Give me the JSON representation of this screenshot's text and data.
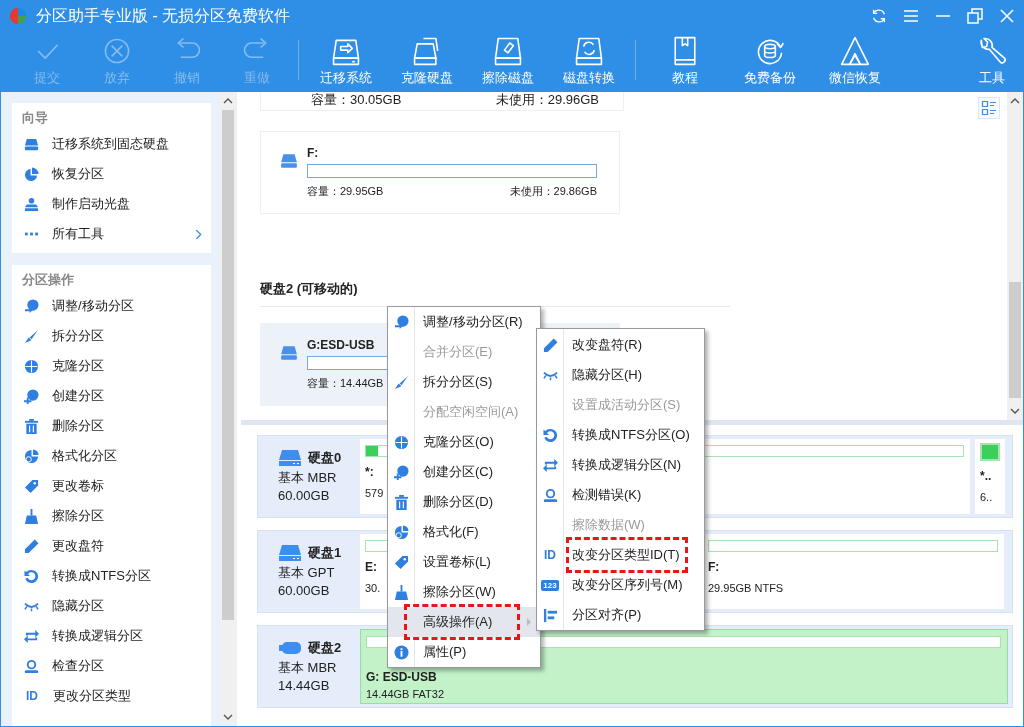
{
  "window": {
    "title": "分区助手专业版 - 无损分区免费软件"
  },
  "toolbar": {
    "groups": [
      [
        {
          "label": "提交",
          "disabled": true
        },
        {
          "label": "放弃",
          "disabled": true
        },
        {
          "label": "撤销",
          "disabled": true
        },
        {
          "label": "重做",
          "disabled": true
        }
      ],
      [
        {
          "label": "迁移系统",
          "disabled": false
        },
        {
          "label": "克隆硬盘",
          "disabled": false
        },
        {
          "label": "擦除磁盘",
          "disabled": false
        },
        {
          "label": "磁盘转换",
          "disabled": false
        }
      ],
      [
        {
          "label": "教程",
          "disabled": false
        },
        {
          "label": "免费备份",
          "disabled": false
        },
        {
          "label": "微信恢复",
          "disabled": false
        }
      ],
      [
        {
          "label": "工具",
          "disabled": false
        }
      ]
    ]
  },
  "sidebar": {
    "sections": [
      {
        "title": "向导",
        "items": [
          {
            "label": "迁移系统到固态硬盘",
            "has_submenu": false
          },
          {
            "label": "恢复分区",
            "has_submenu": false
          },
          {
            "label": "制作启动光盘",
            "has_submenu": false
          },
          {
            "label": "所有工具",
            "has_submenu": true
          }
        ]
      },
      {
        "title": "分区操作",
        "items": [
          {
            "label": "调整/移动分区",
            "has_submenu": false
          },
          {
            "label": "拆分分区",
            "has_submenu": false
          },
          {
            "label": "克隆分区",
            "has_submenu": false
          },
          {
            "label": "创建分区",
            "has_submenu": false
          },
          {
            "label": "删除分区",
            "has_submenu": false
          },
          {
            "label": "格式化分区",
            "has_submenu": false
          },
          {
            "label": "更改卷标",
            "has_submenu": false
          },
          {
            "label": "擦除分区",
            "has_submenu": false
          },
          {
            "label": "更改盘符",
            "has_submenu": false
          },
          {
            "label": "转换成NTFS分区",
            "has_submenu": false
          },
          {
            "label": "隐藏分区",
            "has_submenu": false
          },
          {
            "label": "转换成逻辑分区",
            "has_submenu": false
          },
          {
            "label": "检查分区",
            "has_submenu": false
          },
          {
            "label": "更改分区类型",
            "has_submenu": false,
            "icon_text": {
              "text": "ID",
              "boxed": false
            }
          }
        ]
      }
    ]
  },
  "volumes": {
    "partial_card": {
      "capacity": "容量：30.05GB",
      "unused": "未使用：29.96GB"
    },
    "cards": [
      {
        "name": "F:",
        "level": 0,
        "capacity": "容量：29.95GB",
        "unused": "未使用：29.86GB",
        "selected": false
      }
    ],
    "disk_heading": "硬盘2 (可移动的)",
    "removable_cards": [
      {
        "name": "G:ESD-USB",
        "level": 0,
        "capacity": "容量：14.44GB",
        "selected": true
      }
    ]
  },
  "disks": [
    {
      "name": "硬盘0",
      "kind": "hdd",
      "scheme": "基本 MBR",
      "size": "60.00GB",
      "partitions": [
        {
          "label": "*:",
          "info": "579",
          "level": 0.02,
          "selected": false
        },
        {
          "label": "*..",
          "info": "6..",
          "level": 1,
          "selected": false
        }
      ]
    },
    {
      "name": "硬盘1",
      "kind": "hdd",
      "scheme": "基本 GPT",
      "size": "60.00GB",
      "partitions": [
        {
          "label": "E:",
          "info": "30.",
          "level": 0,
          "selected": false
        },
        {
          "label": "F:",
          "info": "29.95GB NTFS",
          "level": 0,
          "selected": false
        }
      ]
    },
    {
      "name": "硬盘2",
      "kind": "usb",
      "scheme": "基本 MBR",
      "size": "14.44GB",
      "partitions": [
        {
          "label": "G: ESD-USB",
          "info": "14.44GB FAT32",
          "level": 0,
          "selected": true
        }
      ]
    }
  ],
  "context_menu": {
    "items": [
      {
        "label": "调整/移动分区(R)",
        "disabled": false,
        "hovered": false,
        "annotated": false,
        "has_submenu": false
      },
      {
        "label": "合并分区(E)",
        "disabled": true,
        "hovered": false,
        "annotated": false,
        "has_submenu": false
      },
      {
        "label": "拆分分区(S)",
        "disabled": false,
        "hovered": false,
        "annotated": false,
        "has_submenu": false
      },
      {
        "label": "分配空闲空间(A)",
        "disabled": true,
        "hovered": false,
        "annotated": false,
        "has_submenu": false
      },
      {
        "label": "克隆分区(O)",
        "disabled": false,
        "hovered": false,
        "annotated": false,
        "has_submenu": false
      },
      {
        "label": "创建分区(C)",
        "disabled": false,
        "hovered": false,
        "annotated": false,
        "has_submenu": false
      },
      {
        "label": "删除分区(D)",
        "disabled": false,
        "hovered": false,
        "annotated": false,
        "has_submenu": false
      },
      {
        "label": "格式化(F)",
        "disabled": false,
        "hovered": false,
        "annotated": false,
        "has_submenu": false
      },
      {
        "label": "设置卷标(L)",
        "disabled": false,
        "hovered": false,
        "annotated": false,
        "has_submenu": false
      },
      {
        "label": "擦除分区(W)",
        "disabled": false,
        "hovered": false,
        "annotated": false,
        "has_submenu": false
      },
      {
        "label": "高级操作(A)",
        "disabled": false,
        "hovered": true,
        "annotated": true,
        "has_submenu": true
      },
      {
        "label": "属性(P)",
        "disabled": false,
        "hovered": false,
        "annotated": false,
        "has_submenu": false
      }
    ]
  },
  "submenu": {
    "items": [
      {
        "label": "改变盘符(R)",
        "disabled": false,
        "annotated": false
      },
      {
        "label": "隐藏分区(H)",
        "disabled": false,
        "annotated": false
      },
      {
        "label": "设置成活动分区(S)",
        "disabled": true,
        "annotated": false
      },
      {
        "label": "转换成NTFS分区(O)",
        "disabled": false,
        "annotated": false
      },
      {
        "label": "转换成逻辑分区(N)",
        "disabled": false,
        "annotated": false
      },
      {
        "label": "检测错误(K)",
        "disabled": false,
        "annotated": false
      },
      {
        "label": "擦除数据(W)",
        "disabled": true,
        "annotated": false
      },
      {
        "label": "改变分区类型ID(T)",
        "disabled": false,
        "annotated": true,
        "icon_text": {
          "text": "ID",
          "boxed": false
        }
      },
      {
        "label": "改变分区序列号(M)",
        "disabled": false,
        "annotated": false,
        "icon_text": {
          "text": "123",
          "boxed": true
        }
      },
      {
        "label": "分区对齐(P)",
        "disabled": false,
        "annotated": false
      }
    ]
  }
}
